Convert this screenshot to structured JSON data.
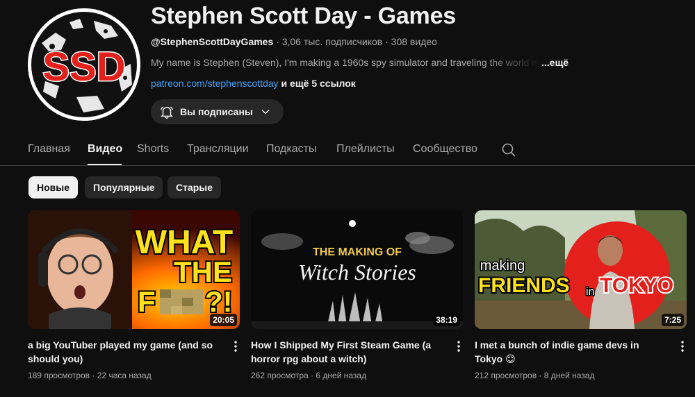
{
  "channel": {
    "avatar_text": "SSD",
    "name": "Stephen Scott Day - Games",
    "handle": "@StephenScottDayGames",
    "subscribers": "3,06 тыс. подписчиков",
    "video_count": "308 видео",
    "description": "My name is Stephen (Steven), I'm making a 1960s spy simulator and traveling the world making games",
    "description_more": "...ещё",
    "link": "patreon.com/stephenscottday",
    "more_links": " и ещё 5 ссылок",
    "subscribe_label": "Вы подписаны",
    "separator": " · "
  },
  "tabs": [
    {
      "label": "Главная"
    },
    {
      "label": "Видео"
    },
    {
      "label": "Shorts"
    },
    {
      "label": "Трансляции"
    },
    {
      "label": "Подкасты"
    },
    {
      "label": "Плейлисты"
    },
    {
      "label": "Сообщество"
    }
  ],
  "chips": [
    {
      "label": "Новые"
    },
    {
      "label": "Популярные"
    },
    {
      "label": "Старые"
    }
  ],
  "videos": [
    {
      "title": "a big YouTuber played my game (and so should you)",
      "duration": "20:05",
      "views": "189 просмотров",
      "age": "22 часа назад",
      "thumb_text": [
        "WHAT",
        "THE",
        "F",
        "?!"
      ]
    },
    {
      "title": "How I Shipped My First Steam Game (a horror rpg about a witch)",
      "duration": "38:19",
      "views": "262 просмотра",
      "age": "6 дней назад",
      "thumb_text": [
        "THE MAKING OF",
        "Witch Stories"
      ]
    },
    {
      "title": "I met a bunch of indie game devs in Tokyo 😊",
      "duration": "7:25",
      "views": "212 просмотров",
      "age": "8 дней назад",
      "thumb_text": [
        "making",
        "FRIENDS",
        "in",
        "TOKYO"
      ]
    }
  ],
  "colors": {
    "background": "#0f0f0f",
    "link": "#3ea6ff",
    "chip_bg": "#272727",
    "accent_red": "#e3201b",
    "thumb_yellow": "#ffe21a"
  },
  "icons": {
    "bell": "bell-icon",
    "chevron": "chevron-down-icon",
    "search": "search-icon",
    "menu": "more-vert-icon"
  }
}
